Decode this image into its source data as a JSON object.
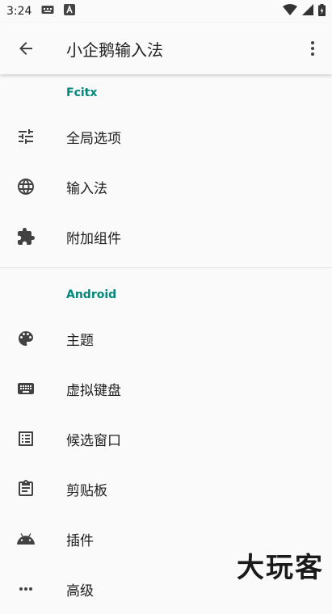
{
  "status_bar": {
    "time": "3:24"
  },
  "app_bar": {
    "title": "小企鹅输入法"
  },
  "sections": [
    {
      "header": "Fcitx",
      "items": [
        {
          "label": "全局选项",
          "icon": "tune-icon"
        },
        {
          "label": "输入法",
          "icon": "globe-icon"
        },
        {
          "label": "附加组件",
          "icon": "puzzle-icon"
        }
      ]
    },
    {
      "header": "Android",
      "items": [
        {
          "label": "主题",
          "icon": "palette-icon"
        },
        {
          "label": "虚拟键盘",
          "icon": "keyboard-icon"
        },
        {
          "label": "候选窗口",
          "icon": "list-icon"
        },
        {
          "label": "剪贴板",
          "icon": "clipboard-icon"
        },
        {
          "label": "插件",
          "icon": "android-icon"
        },
        {
          "label": "高级",
          "icon": "more-horiz-icon"
        }
      ]
    }
  ],
  "watermark": "大玩客",
  "colors": {
    "accent": "#00897b",
    "icon": "#424242"
  }
}
